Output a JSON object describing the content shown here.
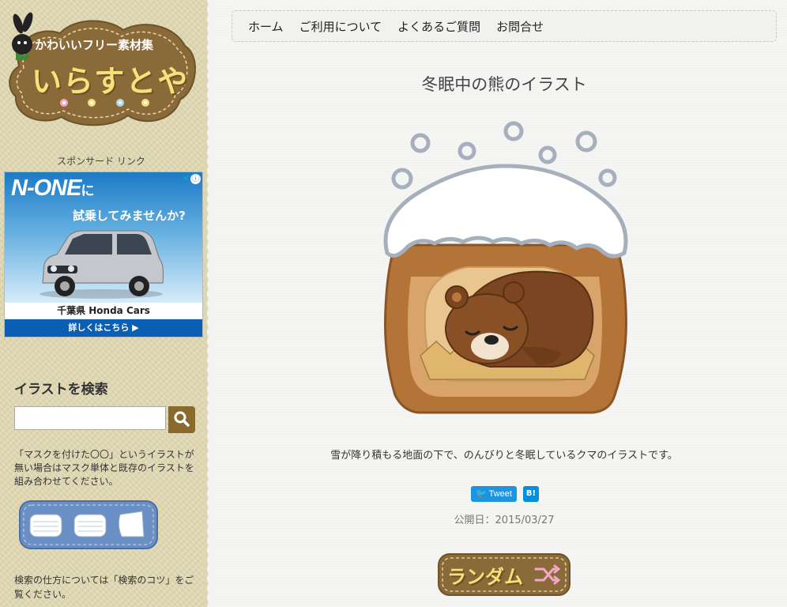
{
  "logo": {
    "subtitle": "かわいいフリー素材集",
    "title": "いらすとや"
  },
  "sidebar": {
    "sponsor_label": "スポンサード リンク",
    "ad": {
      "title": "N-ONE",
      "title_suffix": "に",
      "subtitle": "試乗してみませんか?",
      "dealer": "千葉県 Honda Cars",
      "cta": "詳しくはこちら ▶",
      "info_icon": "ⓘ",
      "close_icon": "✕"
    },
    "search": {
      "heading": "イラストを検索",
      "input_value": "",
      "button_icon": "search-icon"
    },
    "mask_note": "「マスクを付けた〇〇」というイラストが無い場合はマスク単体と既存のイラストを組み合わせてください。",
    "search_tips": "検索の仕方については「検索のコツ」をご覧ください。"
  },
  "nav": {
    "items": [
      "ホーム",
      "ご利用について",
      "よくあるご質問",
      "お問合せ"
    ]
  },
  "post": {
    "title": "冬眠中の熊のイラスト",
    "description": "雪が降り積もる地面の下で、のんびりと冬眠しているクマのイラストです。",
    "share": {
      "tweet": "Tweet",
      "hatena": "B!"
    },
    "published": "公開日：2015/03/27",
    "random_label": "ランダム"
  },
  "colors": {
    "sidebar_bg": "#ddd6b0",
    "logo_brown": "#8b6a3a",
    "search_button": "#8a6a2c",
    "tweet_blue": "#1b95e0",
    "hatena_blue": "#008fde"
  }
}
